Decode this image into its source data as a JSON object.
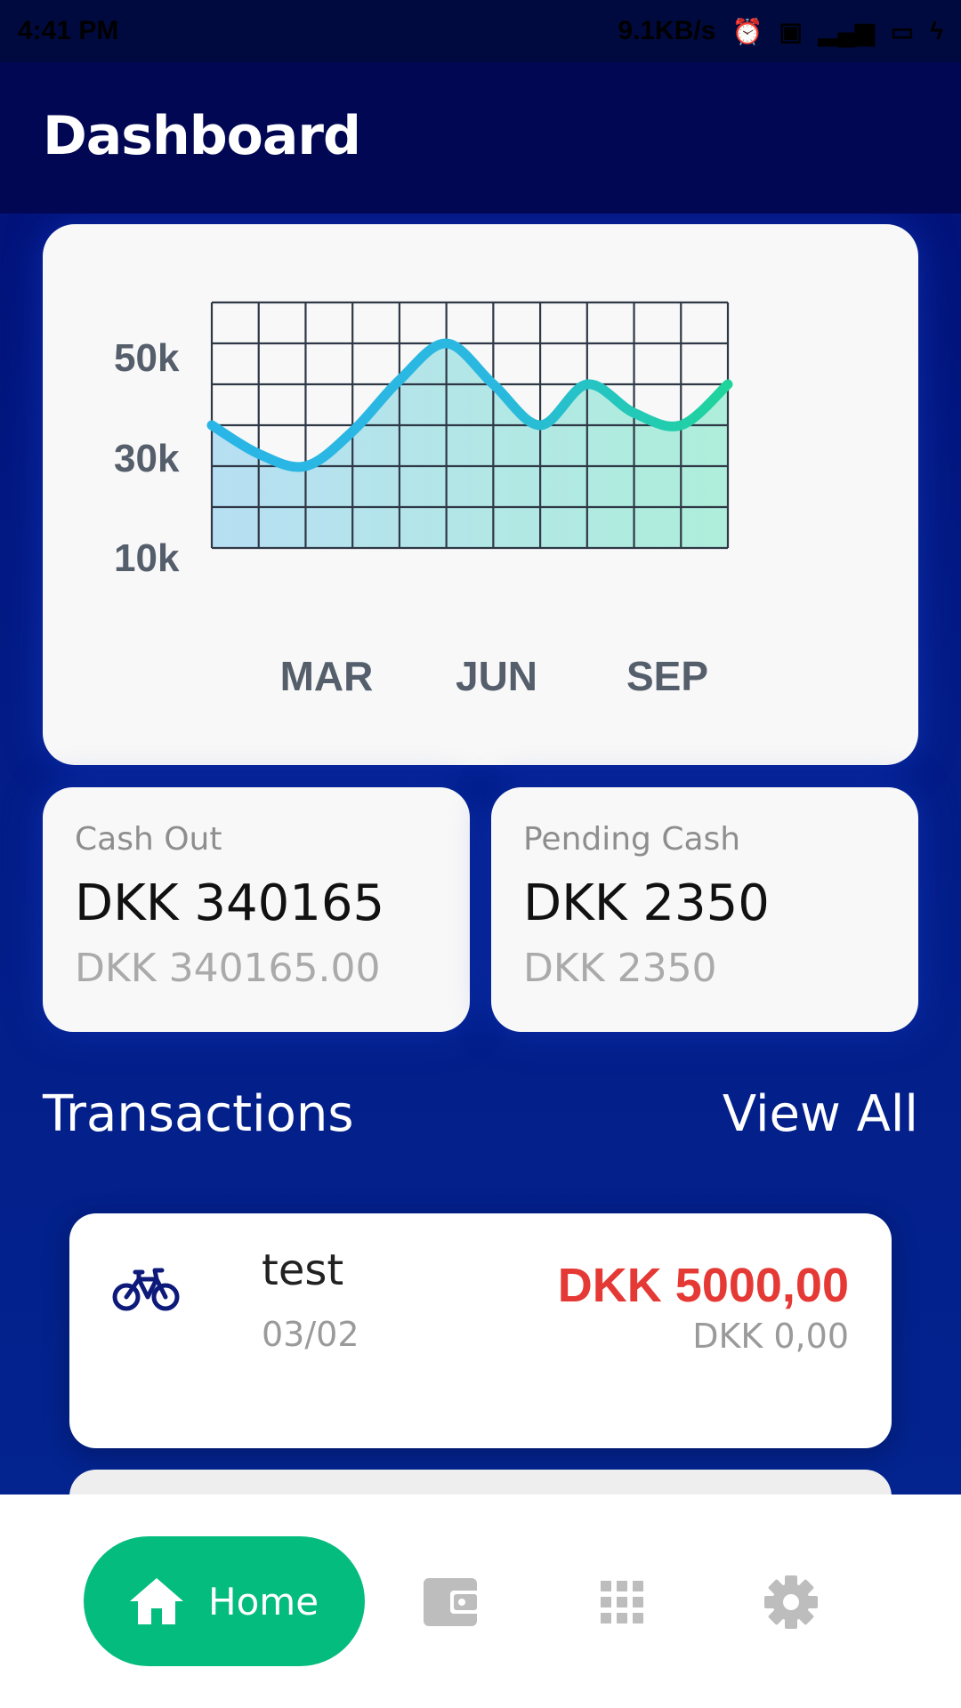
{
  "status_bar": {
    "time": "4:41 PM",
    "speed": "9.1KB/s",
    "icons": [
      "alarm-icon",
      "sim-icon",
      "signal-icon",
      "battery-icon",
      "charging-icon"
    ]
  },
  "header": {
    "title": "Dashboard"
  },
  "chart_data": {
    "type": "area",
    "x_tick_labels": [
      "MAR",
      "JUN",
      "SEP"
    ],
    "y_tick_labels": [
      "50k",
      "30k",
      "10k"
    ],
    "x": [
      1,
      2,
      3,
      4,
      5,
      6,
      7,
      8,
      9,
      10,
      11,
      12
    ],
    "values": [
      30000,
      23000,
      20000,
      28500,
      41000,
      50000,
      40000,
      30000,
      40000,
      33000,
      30000,
      40000
    ],
    "ylim": [
      0,
      60000
    ],
    "grid": true,
    "colors": {
      "start": "#29b6e6",
      "end": "#1fd49b",
      "grid": "#2f3846"
    }
  },
  "stats": {
    "cash_out": {
      "label": "Cash Out",
      "value": "DKK 340165",
      "sub": "DKK 340165.00"
    },
    "pending": {
      "label": "Pending Cash",
      "value": "DKK 2350",
      "sub": "DKK 2350"
    }
  },
  "transactions": {
    "title": "Transactions",
    "view_all": "View All",
    "items": [
      {
        "icon": "bicycle-icon",
        "title": "test",
        "date": "03/02",
        "amount": "DKK 5000,00",
        "sub": "DKK 0,00"
      }
    ]
  },
  "nav": {
    "home_label": "Home",
    "items": [
      "home-icon",
      "wallet-icon",
      "grid-icon",
      "gear-icon"
    ],
    "accent": "#05bc7f"
  }
}
